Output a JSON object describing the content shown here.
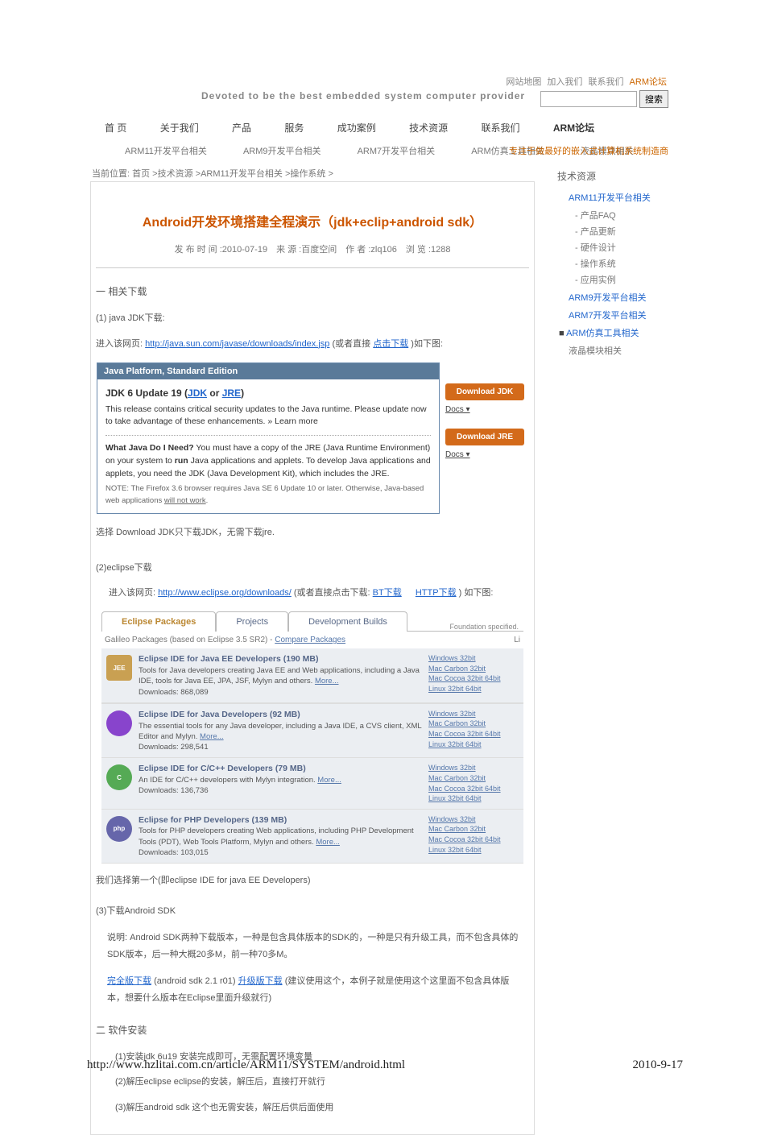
{
  "top_links": [
    "网站地图",
    "加入我们",
    "联系我们",
    "ARM论坛"
  ],
  "search_btn": "搜索",
  "slogan": "Devoted to be the best embedded system computer provider",
  "main_nav": [
    "首 页",
    "关于我们",
    "产品",
    "服务",
    "成功案例",
    "技术资源",
    "联系我们",
    "ARM论坛"
  ],
  "sub_nav": [
    "ARM11开发平台相关",
    "ARM9开发平台相关",
    "ARM7开发平台相关",
    "ARM仿真工具相关",
    "液晶模块相关"
  ],
  "right_note": "专注于做最好的嵌入式计算机系统制造商",
  "breadcrumb": "当前位置: 首页 >技术资源 >ARM11开发平台相关 >操作系统 >",
  "article": {
    "title": "Android开发环境搭建全程演示（jdk+eclip+android sdk）",
    "meta": "发 布 时 间 :2010-07-19　来 源 :百度空间　作 者 :zlq106　浏 览 :1288"
  },
  "sec1_title": "一 相关下载",
  "sec1_p1": "(1) java JDK下载:",
  "sec1_p2_a": "进入该网页: ",
  "sec1_p2_link": "http://java.sun.com/javase/downloads/index.jsp",
  "sec1_p2_b": " (或者直接",
  "sec1_p2_link2": "点击下载",
  "sec1_p2_c": ")如下图:",
  "java_panel": {
    "header": "Java Platform, Standard Edition",
    "title_a": "JDK 6 Update 19 (",
    "title_l1": "JDK",
    "title_mid": " or ",
    "title_l2": "JRE",
    "title_b": ")",
    "p1": "This release contains critical security updates to the Java runtime. Please update now to take advantage of these enhancements.  » Learn more",
    "p2_a": "What Java Do I Need?",
    "p2_b": " You must have a copy of the JRE (Java Runtime Environment) on your system to ",
    "p2_c": "run",
    "p2_d": " Java applications and applets. To develop Java applications and applets, you need the JDK (Java Development Kit), which includes the JRE.",
    "p3_a": "NOTE: The Firefox 3.6 browser requires Java SE 6 Update 10 or later. Otherwise, Java-based web applications ",
    "p3_b": "will not work",
    "p3_c": ".",
    "btn_jdk": "Download JDK",
    "docs": "Docs ▾",
    "btn_jre": "Download JRE",
    "docs2": "Docs ▾"
  },
  "sec1_p3": "选择 Download JDK只下载JDK，无需下载jre.",
  "sec1_p4": "(2)eclipse下载",
  "sec1_p5_a": "进入该网页: ",
  "sec1_p5_link": "http://www.eclipse.org/downloads/",
  "sec1_p5_b": " (或者直接点击下载:",
  "sec1_p5_link2": "BT下载",
  "sec1_p5_sep": "　",
  "sec1_p5_link3": "HTTP下载",
  "sec1_p5_c": ") 如下图:",
  "eclipse": {
    "tabs": [
      "Eclipse Packages",
      "Projects",
      "Development Builds"
    ],
    "right_note": "Foundation specified.",
    "sub_a": "Galileo Packages (based on Eclipse 3.5 SR2) - ",
    "sub_link": "Compare Packages",
    "sub_b": "Li",
    "pkgs": [
      {
        "icon_txt": "JEE",
        "icon_cls": "icon-jee",
        "title": "Eclipse IDE for Java EE Developers (190 MB)",
        "desc": "Tools for Java developers creating Java EE and Web applications, including a Java IDE, tools for Java EE, JPA, JSF, Mylyn and others. ",
        "dl": "Downloads: 868,089"
      },
      {
        "icon_txt": "",
        "icon_cls": "icon-java",
        "title": "Eclipse IDE for Java Developers (92 MB)",
        "desc": "The essential tools for any Java developer, including a Java IDE, a CVS client, XML Editor and Mylyn. ",
        "dl": "Downloads: 298,541"
      },
      {
        "icon_txt": "C",
        "icon_cls": "icon-cpp",
        "title": "Eclipse IDE for C/C++ Developers (79 MB)",
        "desc": "An IDE for C/C++ developers with Mylyn integration. ",
        "dl": "Downloads: 136,736"
      },
      {
        "icon_txt": "php",
        "icon_cls": "icon-php",
        "title": "Eclipse for PHP Developers (139 MB)",
        "desc": "Tools for PHP developers creating Web applications, including PHP Development Tools (PDT), Web Tools Platform, Mylyn and others. ",
        "dl": "Downloads: 103,015"
      }
    ],
    "os_lines": [
      "Windows 32bit",
      "Mac Carbon 32bit",
      "Mac Cocoa 32bit  64bit",
      "Linux 32bit  64bit"
    ],
    "more": "More..."
  },
  "sec1_p6": "我们选择第一个(即eclipse IDE for java EE Developers)",
  "sec1_p7": "(3)下载Android SDK",
  "sec1_p8": "说明: Android SDK两种下载版本，一种是包含具体版本的SDK的，一种是只有升级工具，而不包含具体的SDK版本，后一种大概20多M，前一种70多M。",
  "sec1_p9_link1": "完全版下载",
  "sec1_p9_a": " (android sdk 2.1 r01) ",
  "sec1_p9_link2": "升级版下载",
  "sec1_p9_b": " (建议使用这个，本例子就是使用这个这里面不包含具体版本，想要什么版本在Eclipse里面升级就行)",
  "sec2_title": "二 软件安装",
  "sec2_p1": "(1)安装jdk 6u19  安装完成即可，无需配置环境变量",
  "sec2_p2": "(2)解压eclipse      eclipse的安装，解压后，直接打开就行",
  "sec2_p3": "(3)解压android sdk  这个也无需安装，解压后供后面使用",
  "sidebar": {
    "title": "技术资源",
    "l1": "ARM11开发平台相关",
    "subs": [
      "- 产品FAQ",
      "- 产品更新",
      "- 硬件设计",
      "- 操作系统",
      "- 应用实例"
    ],
    "l2": "ARM9开发平台相关",
    "l3": "ARM7开发平台相关",
    "l4": "ARM仿真工具相关",
    "l5": "液晶模块相关"
  },
  "footer": {
    "left": "http://www.hzlitai.com.cn/article/ARM11/SYSTEM/android.html",
    "right": "2010-9-17"
  }
}
